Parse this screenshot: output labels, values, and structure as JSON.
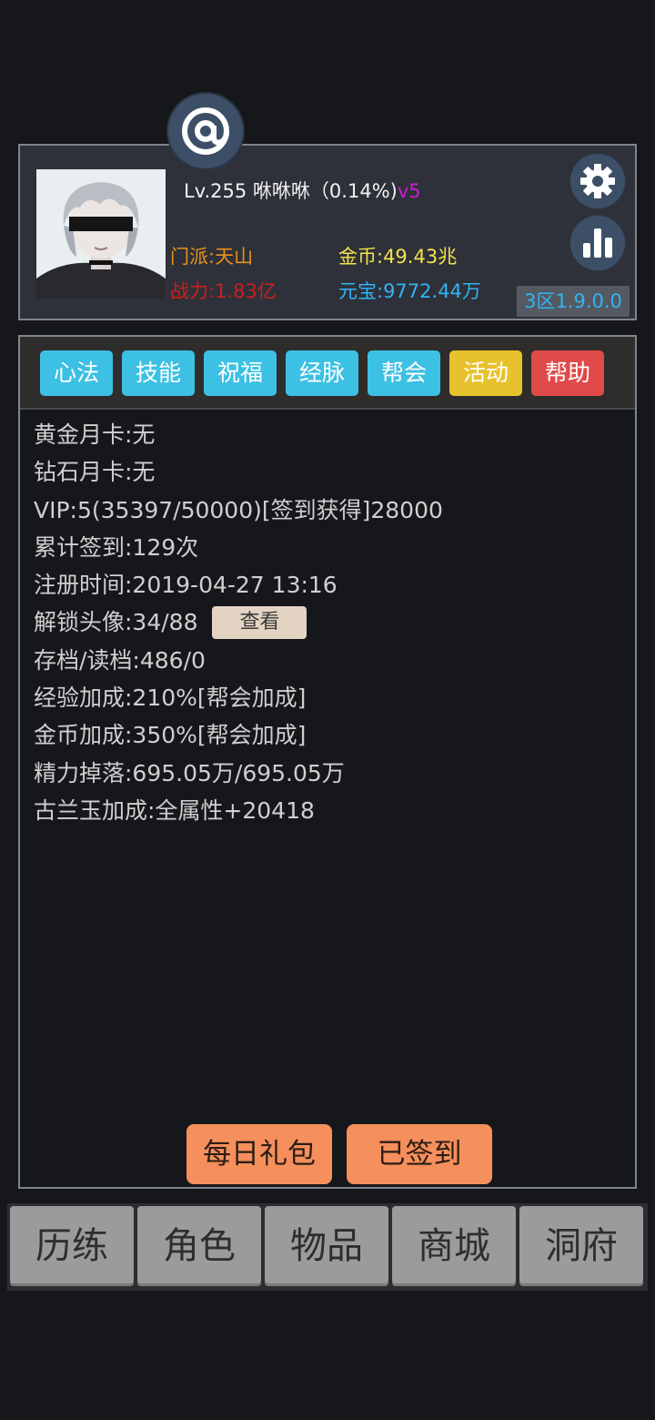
{
  "profile": {
    "level_line": "Lv.255 咻咻咻（0.14%)",
    "vip": "v5",
    "sect": "门派:天山",
    "gold": "金币:49.43兆",
    "power": "战力:1.83亿",
    "ingot": "元宝:9772.44万",
    "server": "3区1.9.0.0"
  },
  "tabs": [
    {
      "label": "心法",
      "color": "#3cc0e3"
    },
    {
      "label": "技能",
      "color": "#3cc0e3"
    },
    {
      "label": "祝福",
      "color": "#3cc0e3"
    },
    {
      "label": "经脉",
      "color": "#3cc0e3"
    },
    {
      "label": "帮会",
      "color": "#3cc0e3"
    },
    {
      "label": "活动",
      "color": "#e8c22c"
    },
    {
      "label": "帮助",
      "color": "#df4a4a"
    }
  ],
  "info": {
    "gold_card": "黄金月卡:无",
    "diamond_card": "钻石月卡:无",
    "vip": "VIP:5(35397/50000)[签到获得]28000",
    "checkin_total": "累计签到:129次",
    "register_time": "注册时间:2019-04-27 13:16",
    "avatar_unlock": "解锁头像:34/88",
    "view_button": "查看",
    "save_load": "存档/读档:486/0",
    "exp_bonus": "经验加成:210%[帮会加成]",
    "gold_bonus": "金币加成:350%[帮会加成]",
    "energy_drop": "精力掉落:695.05万/695.05万",
    "jade_bonus": "古兰玉加成:全属性+20418"
  },
  "buttons": {
    "daily_gift": "每日礼包",
    "checked_in": "已签到"
  },
  "nav": [
    "历练",
    "角色",
    "物品",
    "商城",
    "洞府"
  ]
}
